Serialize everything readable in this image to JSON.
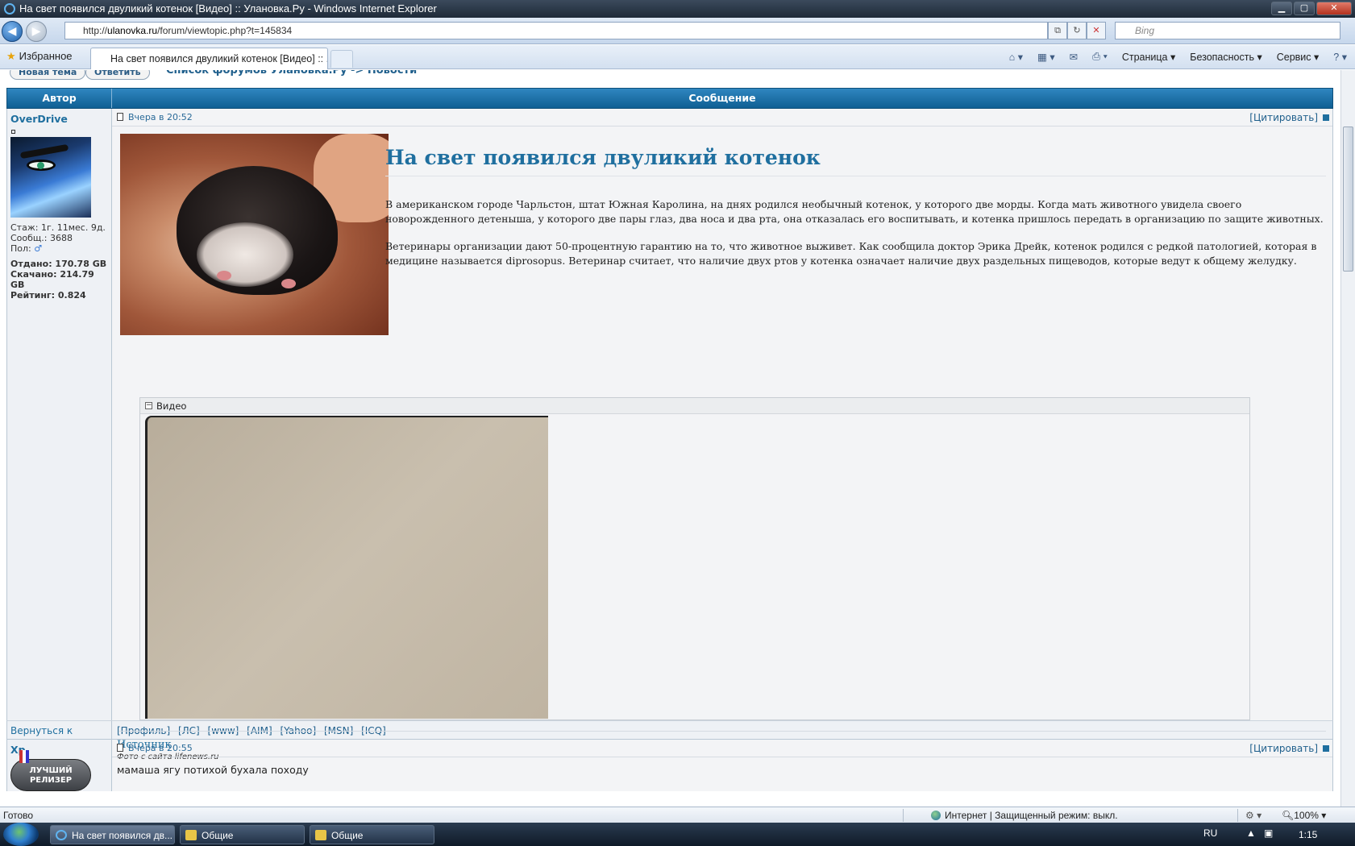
{
  "window": {
    "title": "На свет появился двуликий котенок [Видео] :: Улановка.Ру - Windows Internet Explorer"
  },
  "addressbar": {
    "url_prefix": "http://",
    "url_domain": "ulanovka.ru",
    "url_path": "/forum/viewtopic.php?t=145834",
    "search_placeholder": "Bing"
  },
  "tabbar": {
    "favorites_label": "Избранное",
    "active_tab_title": "На свет появился двуликий котенок [Видео] :: ...",
    "commands": {
      "page": "Страница",
      "safety": "Безопасность",
      "tools": "Сервис"
    }
  },
  "forum": {
    "new_topic_label": "Новая тема",
    "reply_label": "Ответить",
    "breadcrumb": "Список форумов Улановка.Ру -> Новости",
    "col_author": "Автор",
    "col_message": "Сообщение",
    "posts": [
      {
        "author": "OverDrive",
        "stats": {
          "tenure": "Стаж: 1г. 11мес. 9д.",
          "messages": "Сообщ.: 3688",
          "gender": "Пол:",
          "uploaded": "Отдано: 170.78 GB",
          "downloaded": "Скачано: 214.79 GB",
          "rating": "Рейтинг: 0.824"
        },
        "time": "Вчера в 20:52",
        "quote_label": "[Цитировать]",
        "title": "На свет появился двуликий котенок",
        "paragraph1": "В американском городе Чарльстон, штат Южная Каролина, на днях родился необычный котенок, у которого две морды. Когда мать животного увидела своего новорожденного детеныша, у которого две пары глаз, два носа и два рта, она отказалась его воспитывать, и котенка пришлось передать в организацию по защите животных.",
        "paragraph2": "Ветеринары организации дают 50-процентную гарантию на то, что животное выживет. Как сообщила доктор Эрика Дрейк, котенок родился с редкой патологией, которая в медицине называется diprosopus. Ветеринар считает, что наличие двух ртов у котенка означает наличие двух раздельных пищеводов, которые ведут к общему желудку.",
        "spoiler_label": "Видео",
        "source_link": "Источник",
        "photo_caption": "Фото с сайта lifenews.ru"
      },
      {
        "author": "Xp",
        "badge": "ЛУЧШИЙ РЕЛИЗЕР",
        "time": "Вчера в 20:55",
        "quote_label": "[Цитировать]",
        "text": "мамаша ягу потихой бухала походу"
      }
    ],
    "back_to_top": "Вернуться к началу",
    "profile_links": "[Профиль] [ЛС] [www] [AIM] [Yahoo] [MSN] [ICQ]"
  },
  "statusbar": {
    "ready": "Готово",
    "zone": "Интернет | Защищенный режим: выкл.",
    "zoom": "100%"
  },
  "taskbar": {
    "items": [
      "На свет появился дв...",
      "Общие",
      "Общие"
    ],
    "lang": "RU",
    "clock": "1:15"
  },
  "colors": {
    "accent": "#1f6f9f",
    "header_bar": "#0f5f93"
  }
}
